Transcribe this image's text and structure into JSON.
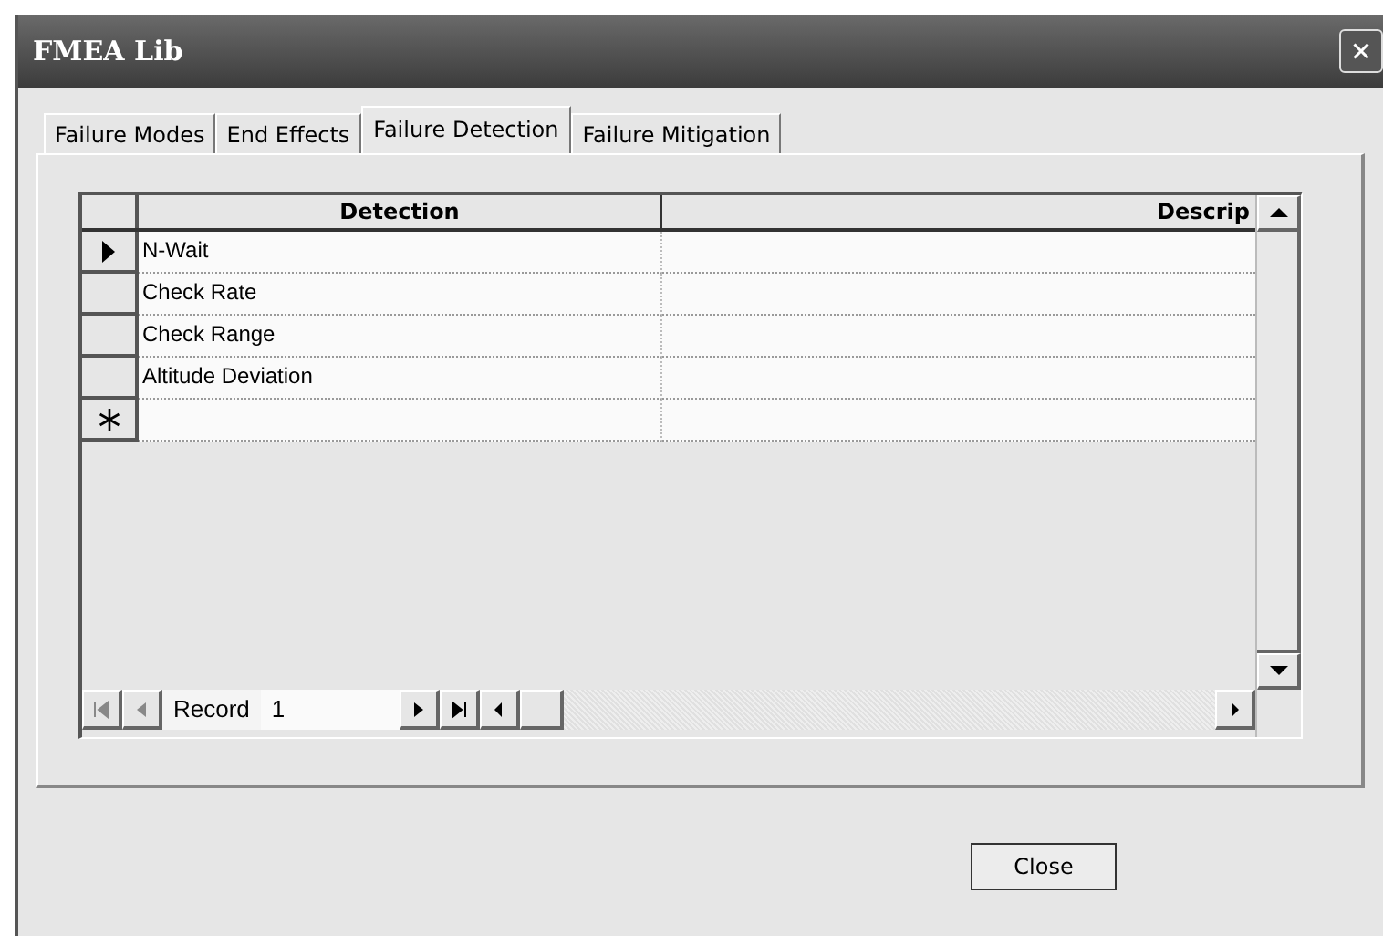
{
  "window": {
    "title": "FMEA Lib"
  },
  "tabs": [
    {
      "label": "Failure Modes",
      "selected": false
    },
    {
      "label": "End Effects",
      "selected": false
    },
    {
      "label": "Failure Detection",
      "selected": true
    },
    {
      "label": "Failure Mitigation",
      "selected": false
    }
  ],
  "table": {
    "columns": [
      "Detection",
      "Descrip"
    ],
    "rows": [
      {
        "kind": "current",
        "cells": [
          "N-Wait",
          ""
        ]
      },
      {
        "kind": "normal",
        "cells": [
          "Check Rate",
          ""
        ]
      },
      {
        "kind": "normal",
        "cells": [
          "Check Range",
          ""
        ]
      },
      {
        "kind": "normal",
        "cells": [
          "Altitude Deviation",
          ""
        ]
      },
      {
        "kind": "new",
        "cells": [
          "",
          ""
        ]
      }
    ]
  },
  "record_nav": {
    "label": "Record",
    "value": "1"
  },
  "buttons": [
    "Close"
  ]
}
